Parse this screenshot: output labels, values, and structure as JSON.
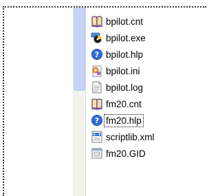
{
  "files": [
    {
      "name": "bpilot.cnt",
      "icon": "book-help-contents-icon",
      "focused": false
    },
    {
      "name": "bpilot.exe",
      "icon": "application-exe-icon",
      "focused": false
    },
    {
      "name": "bpilot.hlp",
      "icon": "help-question-icon",
      "focused": false
    },
    {
      "name": "bpilot.ini",
      "icon": "config-settings-icon",
      "focused": false
    },
    {
      "name": "bpilot.log",
      "icon": "text-document-icon",
      "focused": false
    },
    {
      "name": "fm20.cnt",
      "icon": "book-help-contents-icon",
      "focused": false
    },
    {
      "name": "fm20.hlp",
      "icon": "help-question-icon",
      "focused": true
    },
    {
      "name": "scriptlib.xml",
      "icon": "xml-document-icon",
      "focused": false
    },
    {
      "name": "fm20.GID",
      "icon": "gid-file-icon",
      "focused": false
    }
  ],
  "colors": {
    "selection_frame": "#333333",
    "scroll_thumb": "#c4d3f7",
    "scroll_track": "#f3f3ee"
  }
}
